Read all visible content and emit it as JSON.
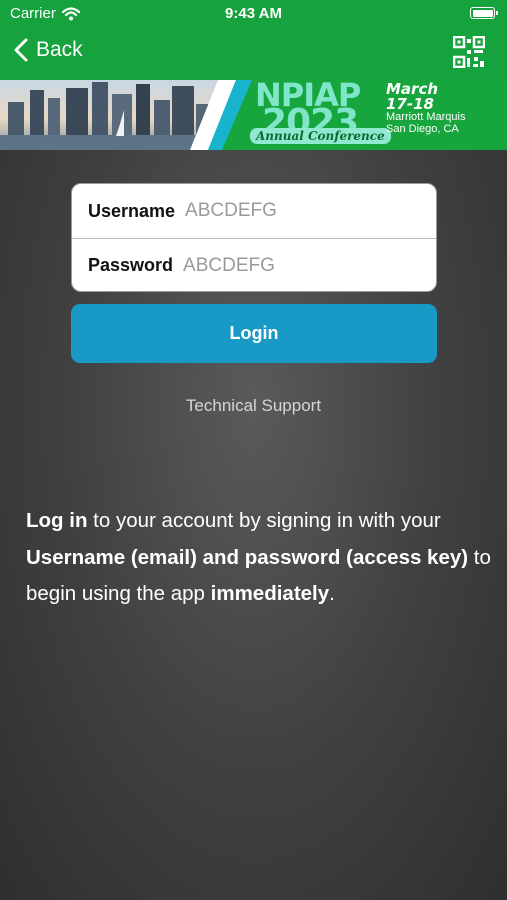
{
  "status_bar": {
    "carrier": "Carrier",
    "time": "9:43 AM"
  },
  "nav": {
    "back_label": "Back",
    "qr_icon": "qr-code-icon"
  },
  "banner": {
    "title": "NPIAP",
    "year": "2023",
    "subtitle": "Annual Conference",
    "date_line1": "March",
    "date_line2": "17-18",
    "venue_line1": "Marriott Marquis",
    "venue_line2": "San Diego, CA"
  },
  "form": {
    "username_label": "Username",
    "username_value": "ABCDEFG",
    "password_label": "Password",
    "password_value": "ABCDEFG"
  },
  "login_label": "Login",
  "support_label": "Technical Support",
  "info": {
    "seg1": "Log in",
    "seg2": " to your account by signing in with your ",
    "seg3": "Username (email) and password (access key)",
    "seg4": " to begin using the app ",
    "seg5": "immediately",
    "seg6": "."
  },
  "colors": {
    "header_green": "#16a23c",
    "button_blue": "#199ac6",
    "background_dark": "#3f3f3f"
  }
}
